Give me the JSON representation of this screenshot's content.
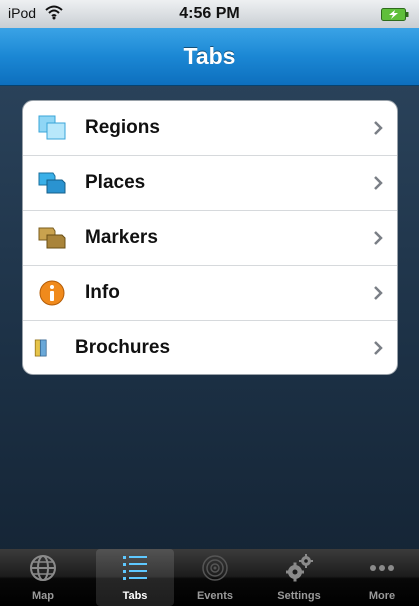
{
  "status_bar": {
    "carrier": "iPod",
    "time": "4:56 PM"
  },
  "nav": {
    "title": "Tabs"
  },
  "list": {
    "items": [
      {
        "label": "Regions",
        "icon": "regions-icon"
      },
      {
        "label": "Places",
        "icon": "places-icon"
      },
      {
        "label": "Markers",
        "icon": "markers-icon"
      },
      {
        "label": "Info",
        "icon": "info-icon"
      },
      {
        "label": "Brochures",
        "icon": "brochures-icon"
      }
    ]
  },
  "tab_bar": {
    "selected": "Tabs",
    "tabs": [
      {
        "label": "Map",
        "icon": "globe-icon"
      },
      {
        "label": "Tabs",
        "icon": "list-icon"
      },
      {
        "label": "Events",
        "icon": "target-icon"
      },
      {
        "label": "Settings",
        "icon": "gears-icon"
      },
      {
        "label": "More",
        "icon": "more-dots-icon"
      }
    ]
  },
  "colors": {
    "nav_bar": "#1b87d4",
    "background": "#1d3247",
    "info_icon": "#f08a1c",
    "tab_bar": "#1c1c1c"
  }
}
